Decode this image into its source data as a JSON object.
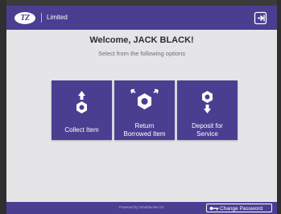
{
  "header": {
    "logo_text": "TZ",
    "brand": "Limited",
    "exit_icon": "logout-icon"
  },
  "main": {
    "welcome": "Welcome, JACK BLACK!",
    "subtitle": "Select from the following options",
    "tiles": [
      {
        "label": "Collect Item",
        "icon": "collect-item-icon"
      },
      {
        "label_line1": "Return",
        "label_line2": "Borrowed Item",
        "icon": "return-item-icon"
      },
      {
        "label_line1": "Deposit for",
        "label_line2": "Service",
        "icon": "deposit-service-icon"
      }
    ]
  },
  "footer": {
    "powered_by": "Powered by Smartlocker Inc",
    "change_password": "Change Password",
    "key_icon": "key-icon"
  },
  "colors": {
    "primary": "#4a3e91",
    "background": "#e5e5e8",
    "text_dark": "#2d2d2d"
  }
}
